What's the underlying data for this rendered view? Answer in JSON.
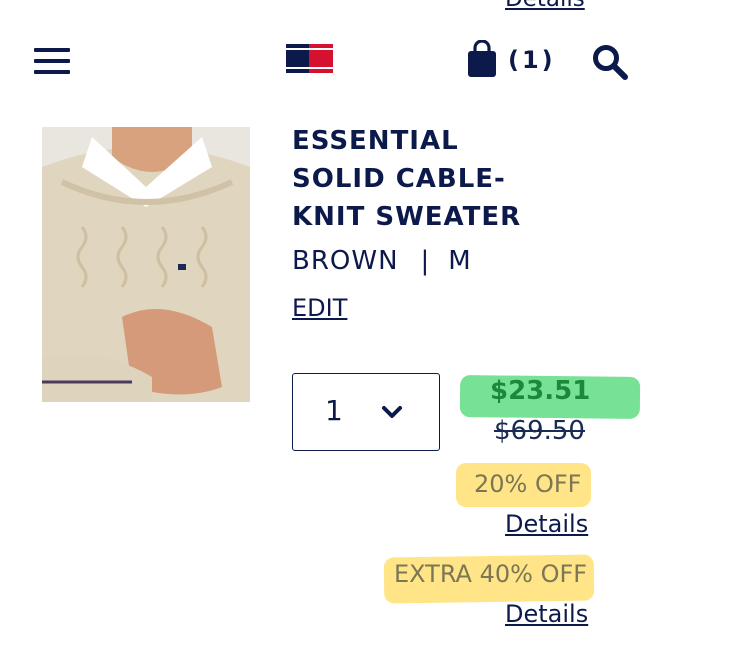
{
  "header": {
    "top_details_label": "Details",
    "cart_count": "(1)"
  },
  "product": {
    "title": "ESSENTIAL SOLID CABLE-KNIT SWEATER",
    "color": "BROWN",
    "separator": "|",
    "size": "M",
    "edit_label": "EDIT",
    "quantity": "1",
    "sale_price": "$23.51",
    "original_price": "$69.50",
    "promotions": [
      {
        "label": "20% OFF",
        "details_label": "Details"
      },
      {
        "label": "EXTRA 40% OFF",
        "details_label": "Details"
      }
    ]
  },
  "colors": {
    "navy": "#0b1a4a",
    "brand_red": "#d4122f",
    "sale_green": "#1a8a3a",
    "highlight_green": "#5fdc84",
    "highlight_yellow": "#ffe27a"
  },
  "icons": [
    "menu-icon",
    "brand-flag-logo",
    "shopping-bag-icon",
    "search-icon",
    "chevron-down-icon"
  ]
}
